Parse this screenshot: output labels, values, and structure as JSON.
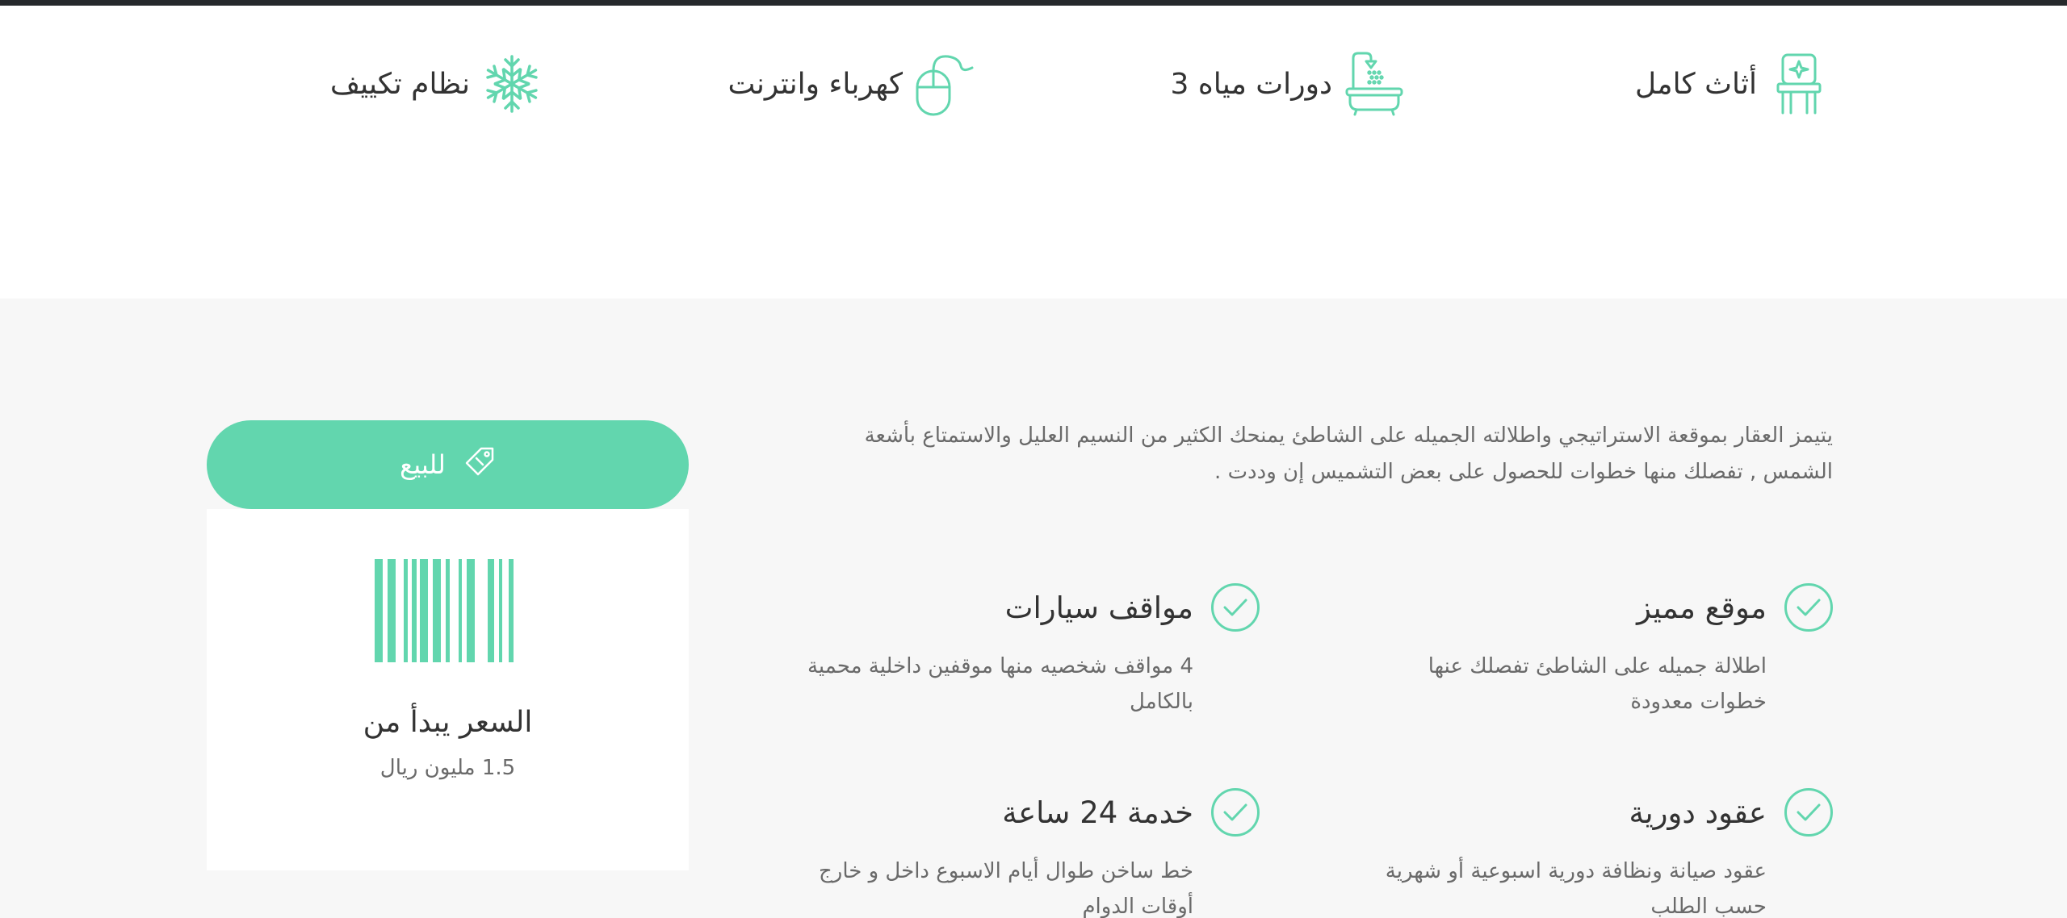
{
  "amenities": [
    {
      "label": "أثاث كامل",
      "icon": "chair-icon"
    },
    {
      "label": "3 دورات مياه",
      "icon": "bathtub-icon"
    },
    {
      "label": "كهرباء وانترنت",
      "icon": "mouse-icon"
    },
    {
      "label": "نظام تكييف",
      "icon": "snowflake-icon"
    }
  ],
  "description": "يتيمز العقار بموقعة الاستراتيجي واطلالته الجميله على الشاطئ يمنحك الكثير من النسيم العليل والاستمتاع بأشعة الشمس , تفصلك منها خطوات للحصول على بعض التشميس إن وددت .",
  "features": [
    {
      "title": "موقع مميز",
      "text": "اطلالة جميله على الشاطئ تفصلك عنها خطوات معدودة"
    },
    {
      "title": "مواقف سيارات",
      "text": "4 مواقف شخصيه منها موقفين داخلية محمية بالكامل"
    },
    {
      "title": "عقود دورية",
      "text": "عقود صيانة ونظافة دورية اسبوعية أو شهرية حسب الطلب"
    },
    {
      "title": "خدمة 24 ساعة",
      "text": "خط ساخن طوال أيام الاسبوع داخل و خارج أوقات الدوام"
    }
  ],
  "sale": {
    "label": "للبيع",
    "icon": "tag-icon"
  },
  "price": {
    "title": "السعر يبدأ من",
    "value": "1.5 مليون ريال",
    "icon": "barcode-icon"
  },
  "colors": {
    "accent": "#62d6ae",
    "topbar": "#26292c",
    "section_bg": "#f7f7f7"
  }
}
